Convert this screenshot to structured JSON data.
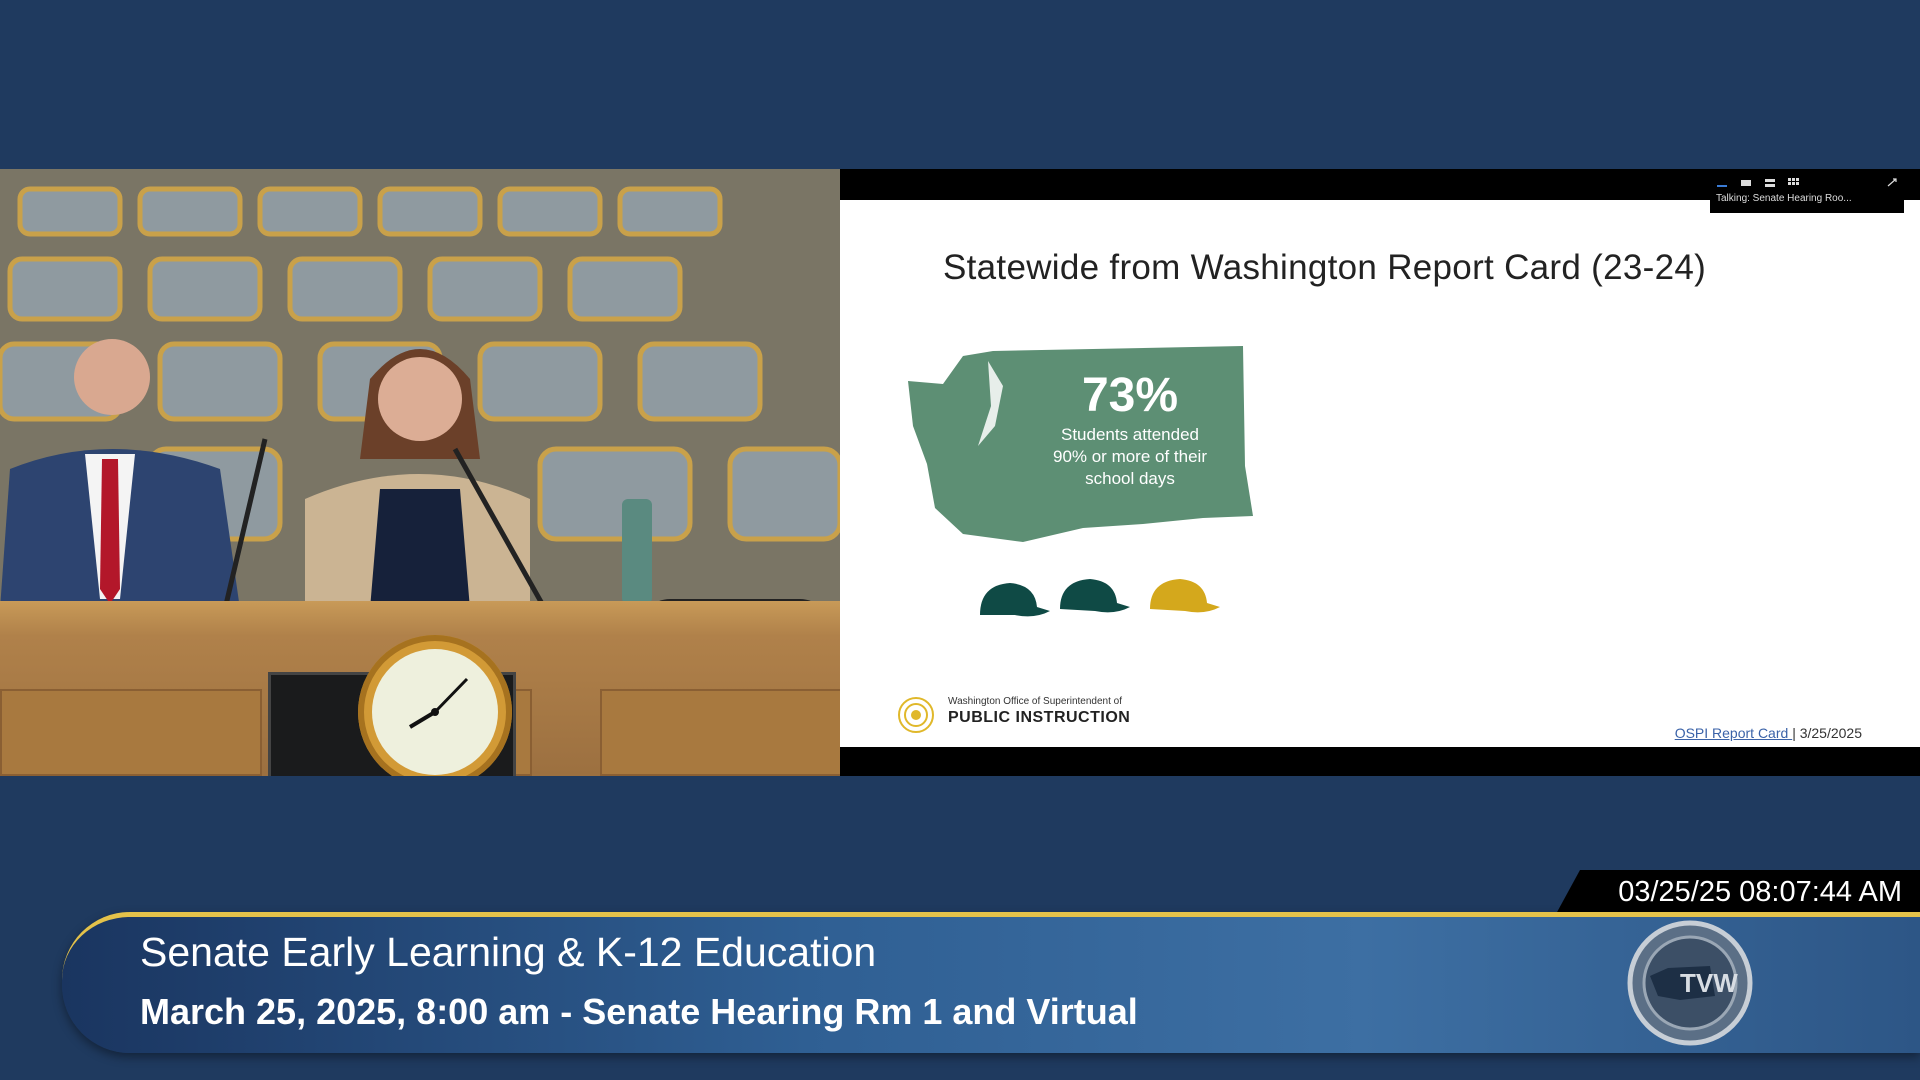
{
  "slide": {
    "title": "Statewide from Washington Report Card (23-24)",
    "stat_value": "73%",
    "stat_label_lines": [
      "Students attended",
      "90% or more of their",
      "school days"
    ],
    "logo_small": "Washington Office of Superintendent of",
    "logo_big": "PUBLIC INSTRUCTION",
    "footer_link": "OSPI Report Card ",
    "footer_sep": "| 3/25/2025"
  },
  "zoom": {
    "talking": "Talking: Senate Hearing Roo..."
  },
  "broadcast": {
    "timestamp": "03/25/25 08:07:44 AM",
    "committee": "Senate Early Learning & K-12 Education",
    "hearing_info": "March 25, 2025, 8:00 am - Senate Hearing Rm 1 and Virtual",
    "network_logo": "TVW"
  },
  "colors": {
    "map_green": "#5d8f74",
    "cap_dark": "#0f4a45",
    "cap_gold": "#d4a81c",
    "banner_gold": "#e4c24a"
  }
}
